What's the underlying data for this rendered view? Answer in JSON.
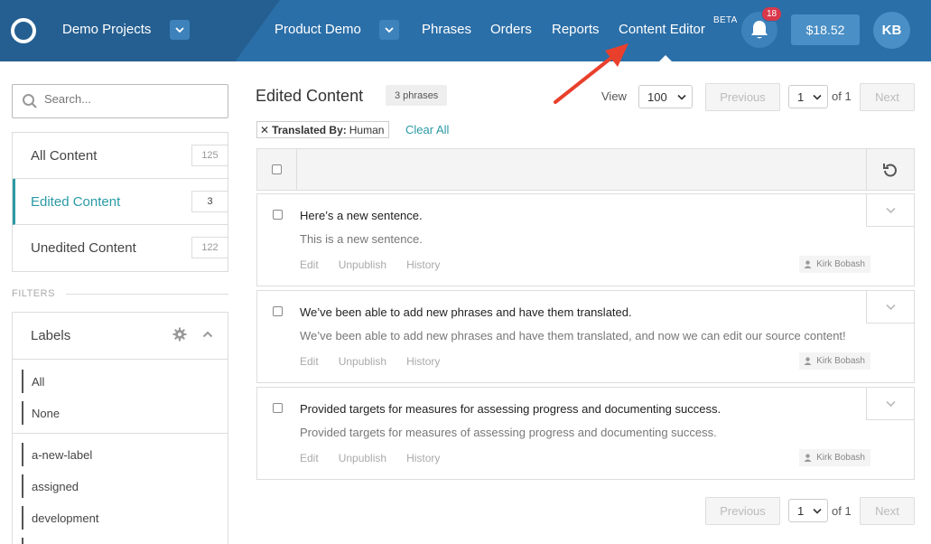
{
  "header": {
    "project": "Demo Projects",
    "subproject": "Product Demo",
    "nav": [
      "Phrases",
      "Orders",
      "Reports",
      "Content Editor"
    ],
    "beta": "BETA",
    "notifications": "18",
    "balance": "$18.52",
    "avatar_initials": "KB"
  },
  "sidebar": {
    "search_placeholder": "Search...",
    "items": [
      {
        "label": "All Content",
        "count": "125"
      },
      {
        "label": "Edited Content",
        "count": "3"
      },
      {
        "label": "Unedited Content",
        "count": "122"
      }
    ],
    "filters_label": "FILTERS",
    "labels_title": "Labels",
    "labels_top": [
      "All",
      "None"
    ],
    "labels_list": [
      "a-new-label",
      "assigned",
      "development"
    ]
  },
  "main": {
    "title": "Edited Content",
    "phrase_count": "3 phrases",
    "view_label": "View",
    "view_value": "100",
    "previous": "Previous",
    "next": "Next",
    "page_value": "1",
    "of_text": "of 1",
    "filter_key": "Translated By:",
    "filter_value": "Human",
    "clear_all": "Clear All",
    "row_actions": [
      "Edit",
      "Unpublish",
      "History"
    ],
    "rows": [
      {
        "source": "Here’s a new sentence.",
        "target": "This is a new sentence.",
        "author": "Kirk Bobash"
      },
      {
        "source": "We’ve been able to add new phrases and have them translated.",
        "target": "We’ve been able to add new phrases and have them translated, and now we can edit our source content!",
        "author": "Kirk Bobash"
      },
      {
        "source": "Provided targets for measures for assessing progress and documenting success.",
        "target": "Provided targets for measures of assessing progress and documenting success.",
        "author": "Kirk Bobash"
      }
    ]
  },
  "colors": {
    "header": "#2b6fa8",
    "accent": "#2a9aa5",
    "badge": "#d8384a",
    "annotation_arrow": "#e8402c"
  }
}
